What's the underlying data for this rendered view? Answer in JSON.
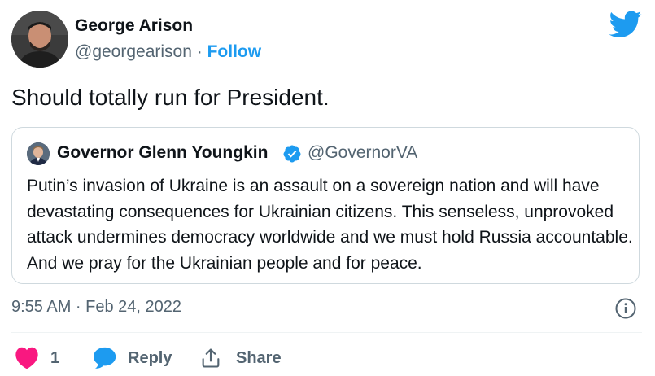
{
  "author": {
    "name": "George Arison",
    "handle": "@georgearison",
    "separator": "·",
    "follow_label": "Follow"
  },
  "brand": {
    "icon": "twitter-bird-icon",
    "color": "#1d9bf0"
  },
  "tweet": {
    "text": "Should totally run for President.",
    "timestamp": "9:55 AM · Feb 24, 2022"
  },
  "quoted_tweet": {
    "author_name": "Governor Glenn Youngkin",
    "verified": true,
    "author_handle": "@GovernorVA",
    "body": "Putin’s invasion of Ukraine is an assault on a sovereign nation and will have devastating consequences for Ukrainian citizens. This senseless, unprovoked attack undermines democracy worldwide and we must hold Russia accountable. And we pray for the Ukrainian people and for peace."
  },
  "actions": {
    "like_count": "1",
    "reply_label": "Reply",
    "share_label": "Share"
  },
  "colors": {
    "like": "#f91880",
    "reply": "#1d9bf0",
    "muted": "#536471",
    "text": "#0f1419",
    "border": "#cfd9de"
  }
}
